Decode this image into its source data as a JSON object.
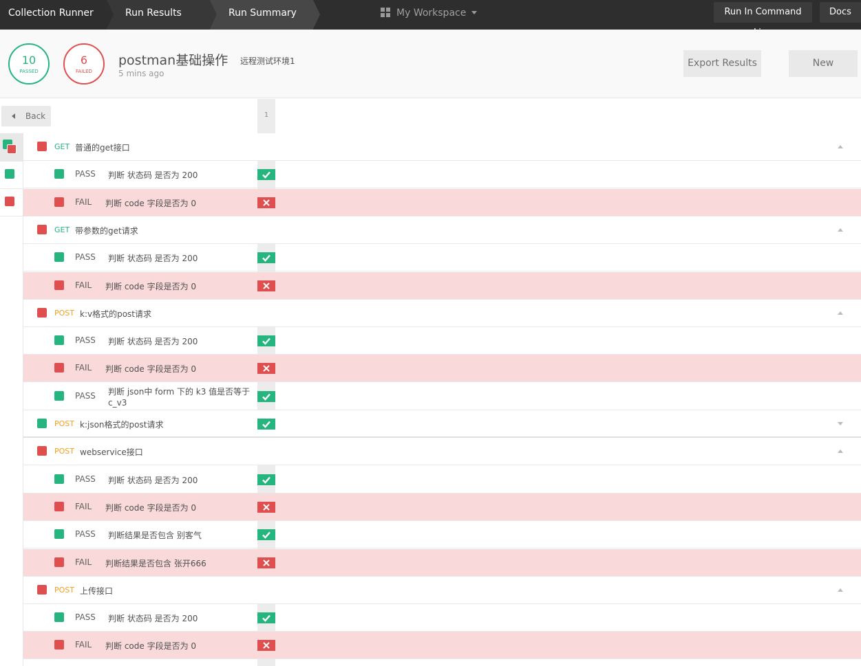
{
  "nav": {
    "crumbs": [
      "Collection Runner",
      "Run Results",
      "Run Summary"
    ],
    "workspace": "My Workspace",
    "run_cli": "Run In Command Line",
    "docs": "Docs"
  },
  "summary": {
    "passed_count": "10",
    "passed_label": "PASSED",
    "failed_count": "6",
    "failed_label": "FAILED",
    "collection_name": "postman基础操作",
    "environment": "远程测试环境1",
    "time_ago": "5 mins ago",
    "export_label": "Export Results",
    "new_label": "New"
  },
  "results": {
    "back_label": "Back",
    "iteration": "1",
    "rows": [
      {
        "kind": "request",
        "status": "fail",
        "method": "GET",
        "name": "普通的get接口",
        "expanded": true
      },
      {
        "kind": "test",
        "result": "PASS",
        "name": "判断 状态码 是否为 200"
      },
      {
        "kind": "test",
        "result": "FAIL",
        "name": "判断 code 字段是否为 0"
      },
      {
        "kind": "request",
        "status": "fail",
        "method": "GET",
        "name": "带参数的get请求",
        "expanded": true
      },
      {
        "kind": "test",
        "result": "PASS",
        "name": "判断 状态码 是否为 200"
      },
      {
        "kind": "test",
        "result": "FAIL",
        "name": "判断 code 字段是否为 0"
      },
      {
        "kind": "request",
        "status": "fail",
        "method": "POST",
        "name": "k:v格式的post请求",
        "expanded": true
      },
      {
        "kind": "test",
        "result": "PASS",
        "name": "判断 状态码 是否为 200"
      },
      {
        "kind": "test",
        "result": "FAIL",
        "name": "判断 code 字段是否为 0"
      },
      {
        "kind": "test",
        "result": "PASS",
        "name": "判断 json中 form 下的 k3 值是否等于 c_v3"
      },
      {
        "kind": "request",
        "status": "pass",
        "method": "POST",
        "name": "k:json格式的post请求",
        "expanded": false
      },
      {
        "kind": "request",
        "status": "fail",
        "method": "POST",
        "name": "webservice接口",
        "expanded": true
      },
      {
        "kind": "test",
        "result": "PASS",
        "name": "判断 状态码 是否为 200"
      },
      {
        "kind": "test",
        "result": "FAIL",
        "name": "判断 code 字段是否为 0"
      },
      {
        "kind": "test",
        "result": "PASS",
        "name": "判断结果是否包含 别客气"
      },
      {
        "kind": "test",
        "result": "FAIL",
        "name": "判断结果是否包含 张开666"
      },
      {
        "kind": "request",
        "status": "fail",
        "method": "POST",
        "name": "上传接口",
        "expanded": true
      },
      {
        "kind": "test",
        "result": "PASS",
        "name": "判断 状态码 是否为 200"
      },
      {
        "kind": "test",
        "result": "FAIL",
        "name": "判断 code 字段是否为 0"
      }
    ]
  },
  "colors": {
    "pass": "#26b47f",
    "fail": "#e04f4f",
    "fail_row": "#f9d9d9",
    "post_method": "#f0a020"
  }
}
